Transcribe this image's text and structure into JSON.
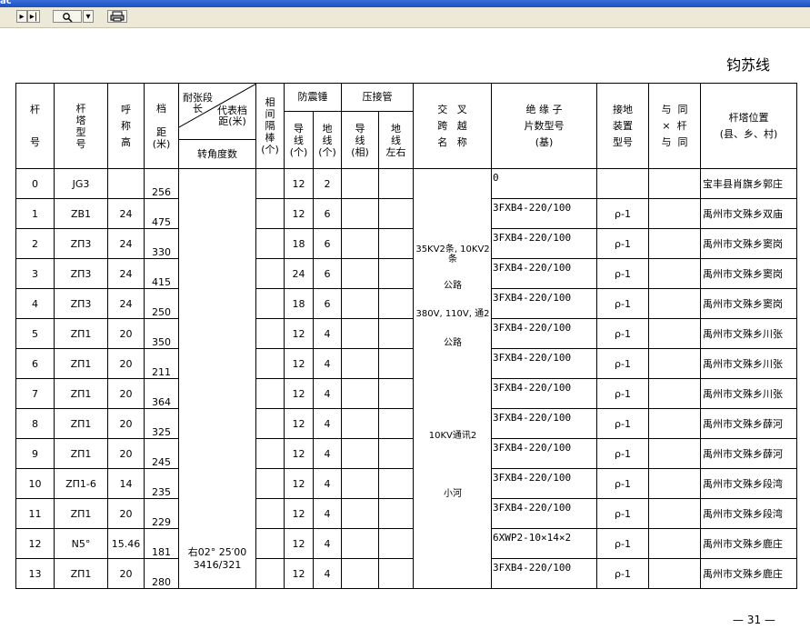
{
  "app": {
    "title": "ас"
  },
  "toolbar": {
    "nav_first": "▸",
    "nav_last": "▸|",
    "zoom_icon": "search-icon",
    "zoom_dropdown": "▾",
    "print_icon": "print-icon"
  },
  "doc": {
    "line_name": "钧苏线",
    "page_number": "— 31 —",
    "headers": {
      "pole_no": "杆号",
      "pole_type": "杆塔型号",
      "nominal_height": "呼称高",
      "span": "档距(米)",
      "tension_section": "耐张段长",
      "rep_span": "代表档距(米)",
      "angle_degree": "转角度数",
      "phase_spacer": "相间隔棒(个)",
      "anti_vibration": "防震锤",
      "av_conductor": "导线(个)",
      "av_ground": "地线(个)",
      "clamp_tube": "压接管",
      "ct_conductor": "导线(相)",
      "ct_ground": "地线左右",
      "crossing_name": "交叉跨越名称",
      "insulator": "绝缘子片数型号(基)",
      "grounding": "接地装置型号",
      "same_pole": "与同×杆与同",
      "location": "杆塔位置(县、乡、村)"
    },
    "rows": [
      {
        "no": "0",
        "type": "JG3",
        "height": "",
        "span": "256",
        "av_c": "12",
        "av_g": "2",
        "insulator": "0",
        "ground": "",
        "location": "宝丰县肖旗乡郭庄"
      },
      {
        "no": "1",
        "type": "ZB1",
        "height": "24",
        "span": "475",
        "av_c": "12",
        "av_g": "6",
        "insulator": "3FXB4-220/100",
        "ground": "ρ-1",
        "location": "禹州市文殊乡双庙"
      },
      {
        "no": "2",
        "type": "ZΠ3",
        "height": "24",
        "span": "330",
        "av_c": "18",
        "av_g": "6",
        "insulator": "3FXB4-220/100",
        "ground": "ρ-1",
        "location": "禹州市文殊乡窦岗"
      },
      {
        "no": "3",
        "type": "ZΠ3",
        "height": "24",
        "span": "415",
        "av_c": "24",
        "av_g": "6",
        "insulator": "3FXB4-220/100",
        "ground": "ρ-1",
        "location": "禹州市文殊乡窦岗"
      },
      {
        "no": "4",
        "type": "ZΠ3",
        "height": "24",
        "span": "250",
        "av_c": "18",
        "av_g": "6",
        "insulator": "3FXB4-220/100",
        "ground": "ρ-1",
        "location": "禹州市文殊乡窦岗"
      },
      {
        "no": "5",
        "type": "ZΠ1",
        "height": "20",
        "span": "350",
        "av_c": "12",
        "av_g": "4",
        "insulator": "3FXB4-220/100",
        "ground": "ρ-1",
        "location": "禹州市文殊乡川张"
      },
      {
        "no": "6",
        "type": "ZΠ1",
        "height": "20",
        "span": "211",
        "av_c": "12",
        "av_g": "4",
        "insulator": "3FXB4-220/100",
        "ground": "ρ-1",
        "location": "禹州市文殊乡川张"
      },
      {
        "no": "7",
        "type": "ZΠ1",
        "height": "20",
        "span": "364",
        "av_c": "12",
        "av_g": "4",
        "insulator": "3FXB4-220/100",
        "ground": "ρ-1",
        "location": "禹州市文殊乡川张"
      },
      {
        "no": "8",
        "type": "ZΠ1",
        "height": "20",
        "span": "325",
        "av_c": "12",
        "av_g": "4",
        "insulator": "3FXB4-220/100",
        "ground": "ρ-1",
        "location": "禹州市文殊乡薛河"
      },
      {
        "no": "9",
        "type": "ZΠ1",
        "height": "20",
        "span": "245",
        "av_c": "12",
        "av_g": "4",
        "insulator": "3FXB4-220/100",
        "ground": "ρ-1",
        "location": "禹州市文殊乡薛河"
      },
      {
        "no": "10",
        "type": "ZΠ1-6",
        "height": "14",
        "span": "235",
        "av_c": "12",
        "av_g": "4",
        "insulator": "3FXB4-220/100",
        "ground": "ρ-1",
        "location": "禹州市文殊乡段湾"
      },
      {
        "no": "11",
        "type": "ZΠ1",
        "height": "20",
        "span": "229",
        "av_c": "12",
        "av_g": "4",
        "insulator": "3FXB4-220/100",
        "ground": "ρ-1",
        "location": "禹州市文殊乡段湾"
      },
      {
        "no": "12",
        "type": "N5°",
        "height": "15.46",
        "span": "181",
        "av_c": "12",
        "av_g": "4",
        "insulator": "6XWP2-10×14×2",
        "ground": "ρ-1",
        "location": "禹州市文殊乡鹿庄"
      },
      {
        "no": "13",
        "type": "ZΠ1",
        "height": "20",
        "span": "280",
        "av_c": "12",
        "av_g": "4",
        "insulator": "3FXB4-220/100",
        "ground": "ρ-1",
        "location": "禹州市文殊乡鹿庄"
      }
    ],
    "crossings": [
      "35KV2条, 10KV2条",
      "公路",
      "380V, 110V, 通2",
      "公路",
      "10KV通讯2",
      "小河"
    ],
    "angle_note": "右02° 25′00",
    "section_note": "3416/321"
  }
}
